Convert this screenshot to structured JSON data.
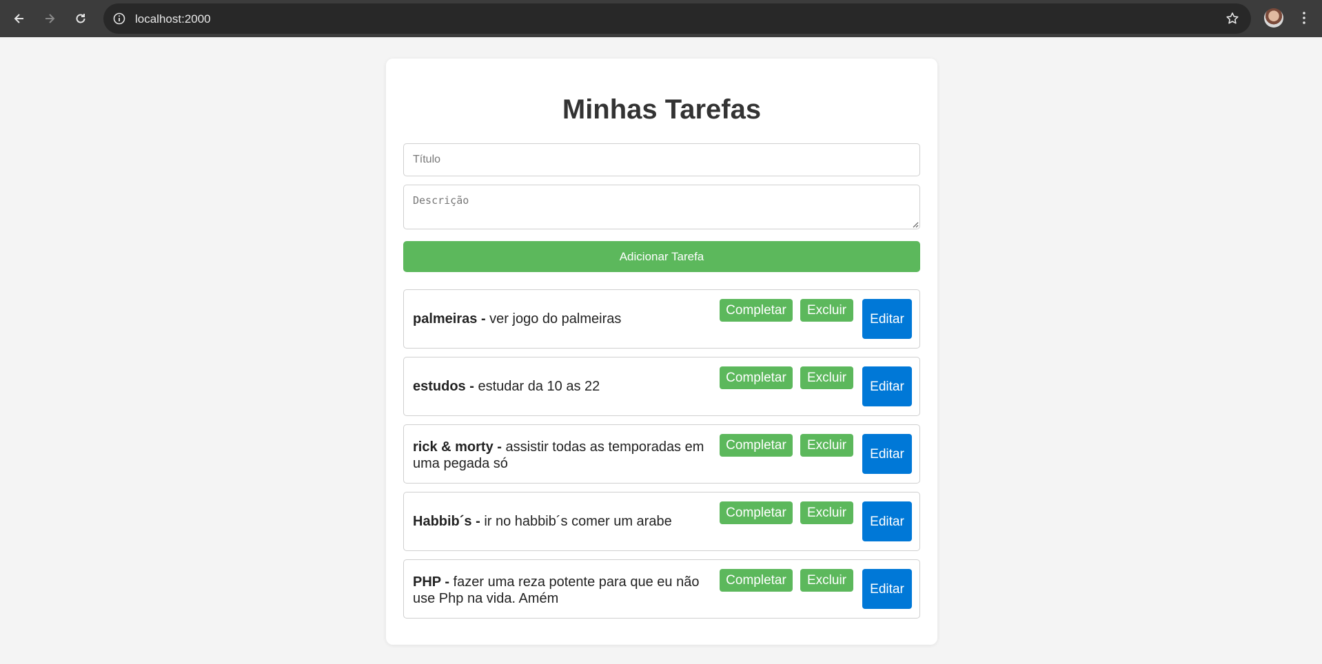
{
  "browser": {
    "url": "localhost:2000",
    "icons": [
      "back-icon",
      "forward-icon",
      "reload-icon",
      "info-icon",
      "star-icon",
      "avatar",
      "menu-icon"
    ]
  },
  "app": {
    "title": "Minhas Tarefas",
    "title_placeholder": "Título",
    "desc_placeholder": "Descrição",
    "add_label": "Adicionar Tarefa"
  },
  "buttons": {
    "complete": "Completar",
    "delete": "Excluir",
    "edit": "Editar"
  },
  "tasks": [
    {
      "title": "palmeiras",
      "description": "ver jogo do palmeiras"
    },
    {
      "title": "estudos",
      "description": "estudar da 10 as 22"
    },
    {
      "title": "rick & morty",
      "description": "assistir todas as temporadas em uma pegada só"
    },
    {
      "title": "Habbib´s",
      "description": "ir no habbib´s comer um arabe"
    },
    {
      "title": "PHP",
      "description": "fazer uma reza potente para que eu não use Php na vida. Amém"
    }
  ],
  "colors": {
    "green": "#5cb85c",
    "blue": "#0078d7",
    "background": "#f4f4f4"
  }
}
